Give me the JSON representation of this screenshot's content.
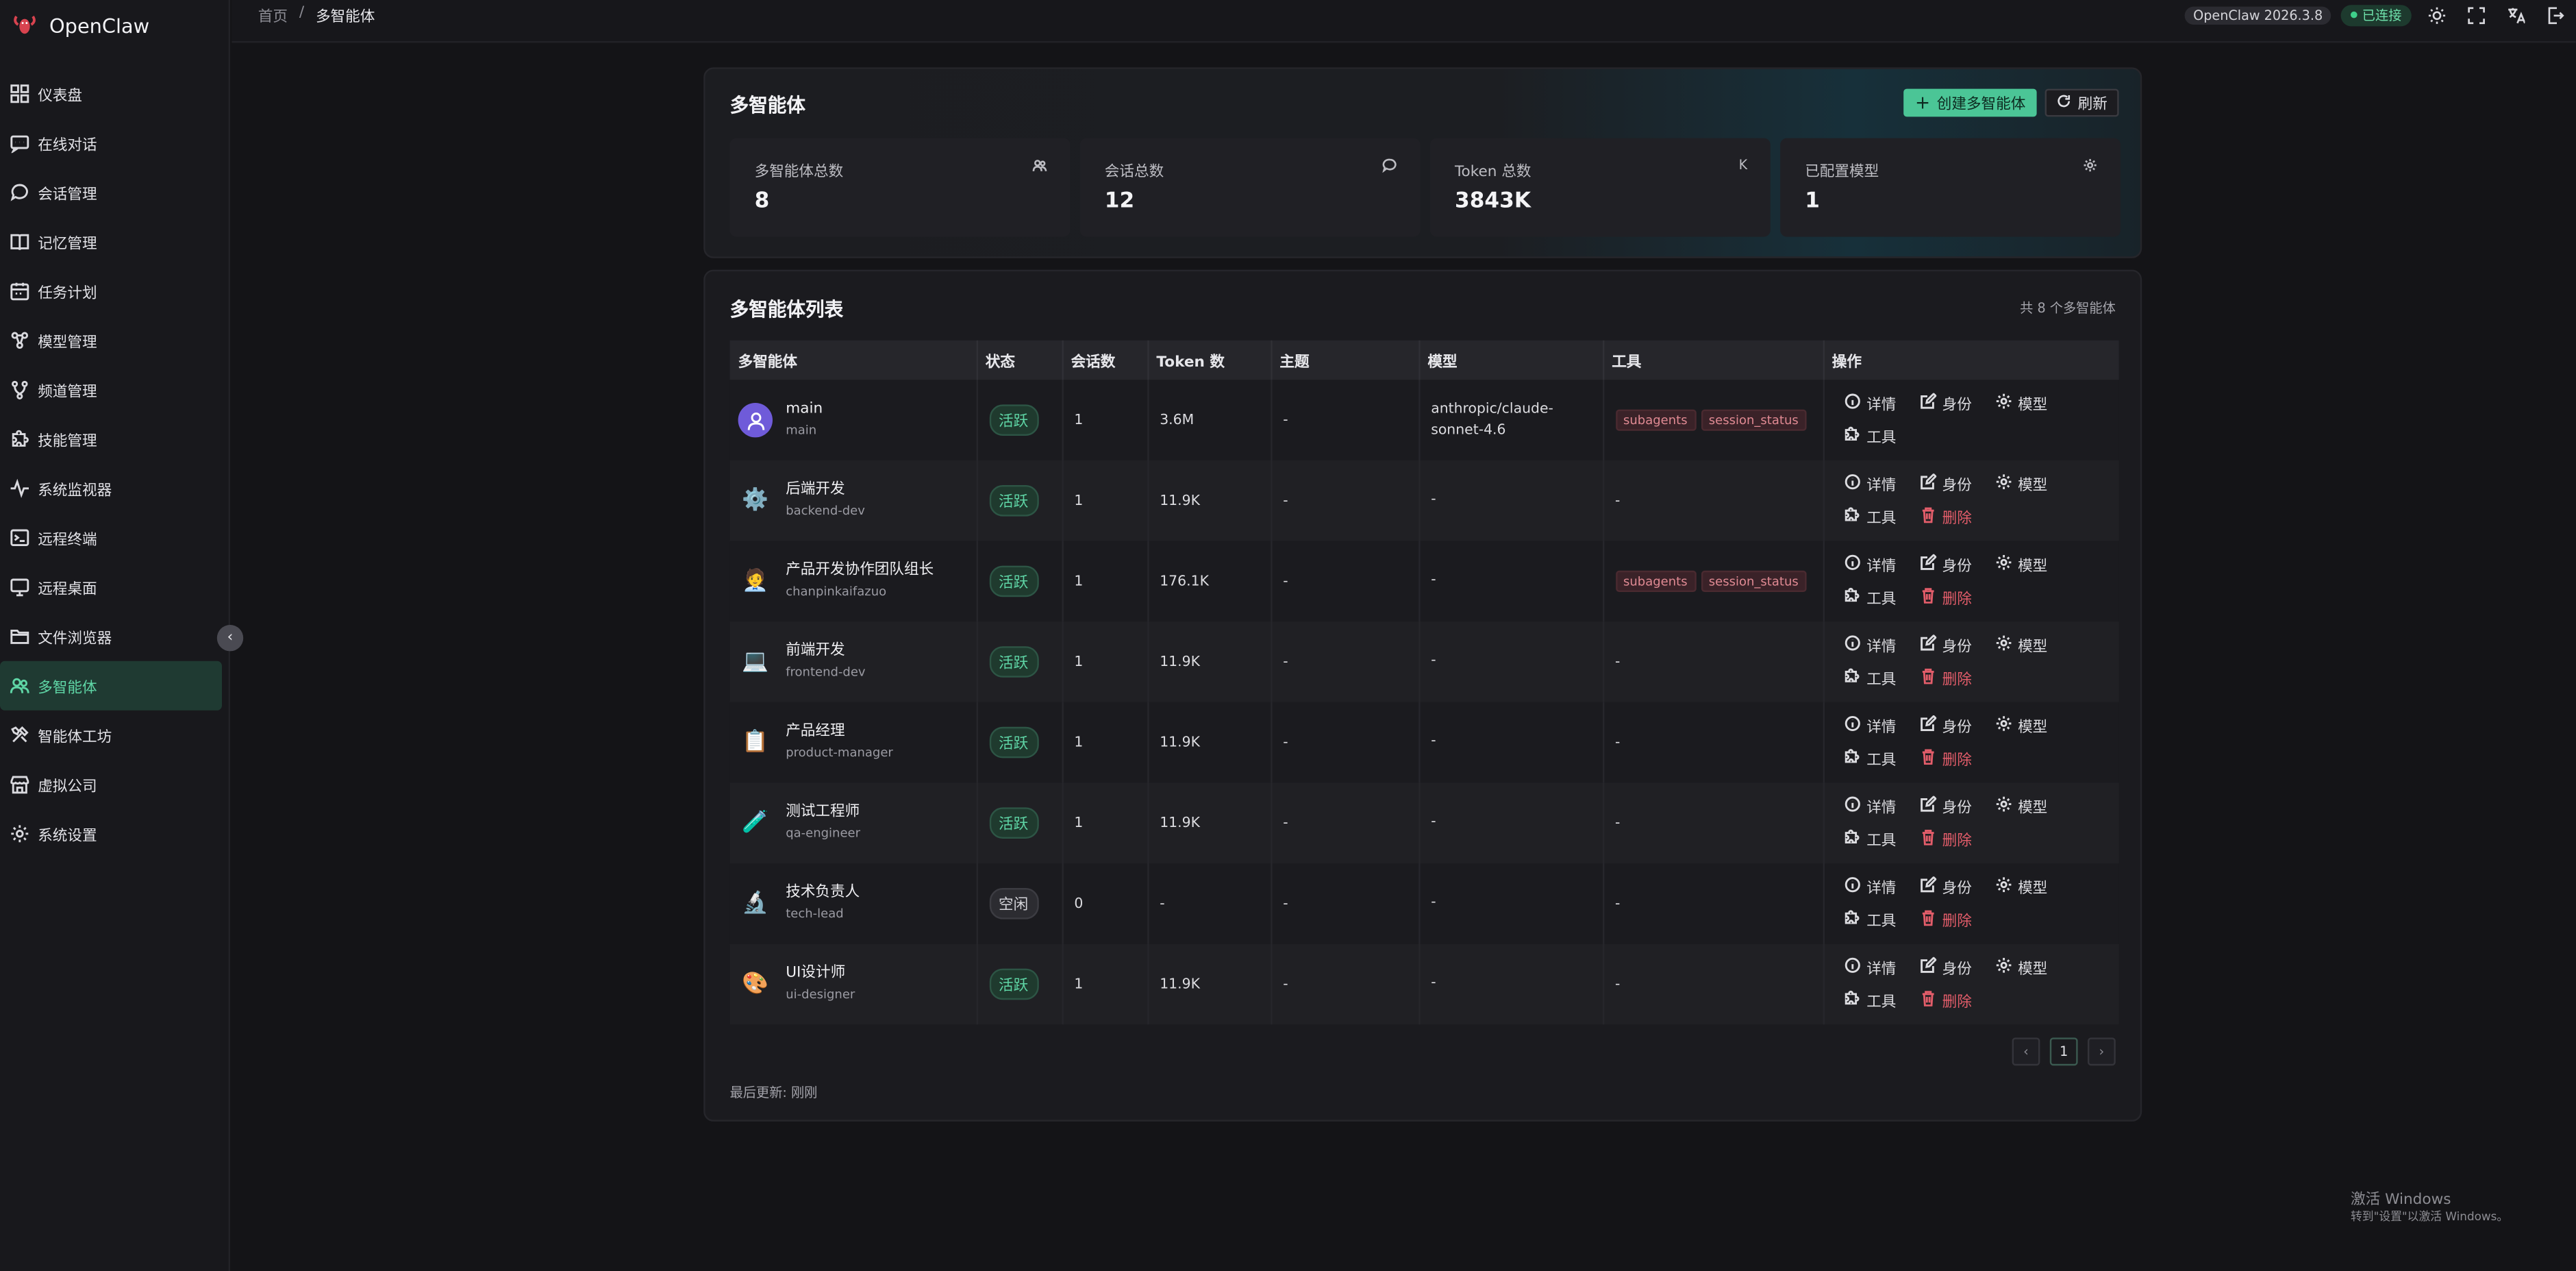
{
  "app": {
    "name": "OpenClaw",
    "version": "OpenClaw 2026.3.8",
    "connection": "已连接"
  },
  "breadcrumb": {
    "home": "首页",
    "separator": "/",
    "current": "多智能体"
  },
  "sidebar": {
    "items": [
      {
        "label": "仪表盘",
        "icon": "dashboard-icon"
      },
      {
        "label": "在线对话",
        "icon": "chat-icon"
      },
      {
        "label": "会话管理",
        "icon": "sessions-icon"
      },
      {
        "label": "记忆管理",
        "icon": "book-icon"
      },
      {
        "label": "任务计划",
        "icon": "calendar-icon"
      },
      {
        "label": "模型管理",
        "icon": "model-icon"
      },
      {
        "label": "频道管理",
        "icon": "branch-icon"
      },
      {
        "label": "技能管理",
        "icon": "puzzle-icon"
      },
      {
        "label": "系统监视器",
        "icon": "pulse-icon"
      },
      {
        "label": "远程终端",
        "icon": "terminal-icon"
      },
      {
        "label": "远程桌面",
        "icon": "monitor-icon"
      },
      {
        "label": "文件浏览器",
        "icon": "folder-icon"
      },
      {
        "label": "多智能体",
        "icon": "users-icon",
        "active": true
      },
      {
        "label": "智能体工坊",
        "icon": "tools-icon"
      },
      {
        "label": "虚拟公司",
        "icon": "store-icon"
      },
      {
        "label": "系统设置",
        "icon": "gear-icon"
      }
    ]
  },
  "summary": {
    "title": "多智能体",
    "create_label": "创建多智能体",
    "refresh_label": "刷新",
    "stats": [
      {
        "label": "多智能体总数",
        "value": "8",
        "icon": "users-icon"
      },
      {
        "label": "会话总数",
        "value": "12",
        "icon": "chat-bubble-icon"
      },
      {
        "label": "Token 总数",
        "value": "3843K",
        "icon_text": "K"
      },
      {
        "label": "已配置模型",
        "value": "1",
        "icon": "gear-icon"
      }
    ]
  },
  "list": {
    "title": "多智能体列表",
    "count_text": "共 8 个多智能体",
    "columns": [
      "多智能体",
      "状态",
      "会话数",
      "Token 数",
      "主题",
      "模型",
      "工具",
      "操作"
    ],
    "action_labels": {
      "detail": "详情",
      "identity": "身份",
      "model": "模型",
      "tools": "工具",
      "delete": "删除"
    },
    "rows": [
      {
        "name": "main",
        "id": "main",
        "avatar": "👤",
        "status": "活跃",
        "status_type": "active",
        "sessions": "1",
        "tokens": "3.6M",
        "topic": "-",
        "model": "anthropic/claude-sonnet-4.6",
        "tools": [
          "subagents",
          "session_status"
        ],
        "deletable": false
      },
      {
        "name": "后端开发",
        "id": "backend-dev",
        "avatar": "⚙️",
        "status": "活跃",
        "status_type": "active",
        "sessions": "1",
        "tokens": "11.9K",
        "topic": "-",
        "model": "-",
        "tools": [],
        "tools_text": "-",
        "deletable": true
      },
      {
        "name": "产品开发协作团队组长",
        "id": "chanpinkaifazuo",
        "avatar": "🧑‍💼",
        "status": "活跃",
        "status_type": "active",
        "sessions": "1",
        "tokens": "176.1K",
        "topic": "-",
        "model": "-",
        "tools": [
          "subagents",
          "session_status"
        ],
        "deletable": true
      },
      {
        "name": "前端开发",
        "id": "frontend-dev",
        "avatar": "💻",
        "status": "活跃",
        "status_type": "active",
        "sessions": "1",
        "tokens": "11.9K",
        "topic": "-",
        "model": "-",
        "tools": [],
        "tools_text": "-",
        "deletable": true
      },
      {
        "name": "产品经理",
        "id": "product-manager",
        "avatar": "📋",
        "status": "活跃",
        "status_type": "active",
        "sessions": "1",
        "tokens": "11.9K",
        "topic": "-",
        "model": "-",
        "tools": [],
        "tools_text": "-",
        "deletable": true
      },
      {
        "name": "测试工程师",
        "id": "qa-engineer",
        "avatar": "🧪",
        "status": "活跃",
        "status_type": "active",
        "sessions": "1",
        "tokens": "11.9K",
        "topic": "-",
        "model": "-",
        "tools": [],
        "tools_text": "-",
        "deletable": true
      },
      {
        "name": "技术负责人",
        "id": "tech-lead",
        "avatar": "🔬",
        "status": "空闲",
        "status_type": "idle",
        "sessions": "0",
        "tokens": "-",
        "topic": "-",
        "model": "-",
        "tools": [],
        "tools_text": "-",
        "deletable": true
      },
      {
        "name": "UI设计师",
        "id": "ui-designer",
        "avatar": "🎨",
        "status": "活跃",
        "status_type": "active",
        "sessions": "1",
        "tokens": "11.9K",
        "topic": "-",
        "model": "-",
        "tools": [],
        "tools_text": "-",
        "deletable": true
      }
    ],
    "pagination": {
      "current": "1",
      "prev": "‹",
      "next": "›"
    },
    "last_update": "最后更新: 刚刚"
  },
  "watermark": {
    "line1": "激活 Windows",
    "line2": "转到\"设置\"以激活 Windows。"
  }
}
